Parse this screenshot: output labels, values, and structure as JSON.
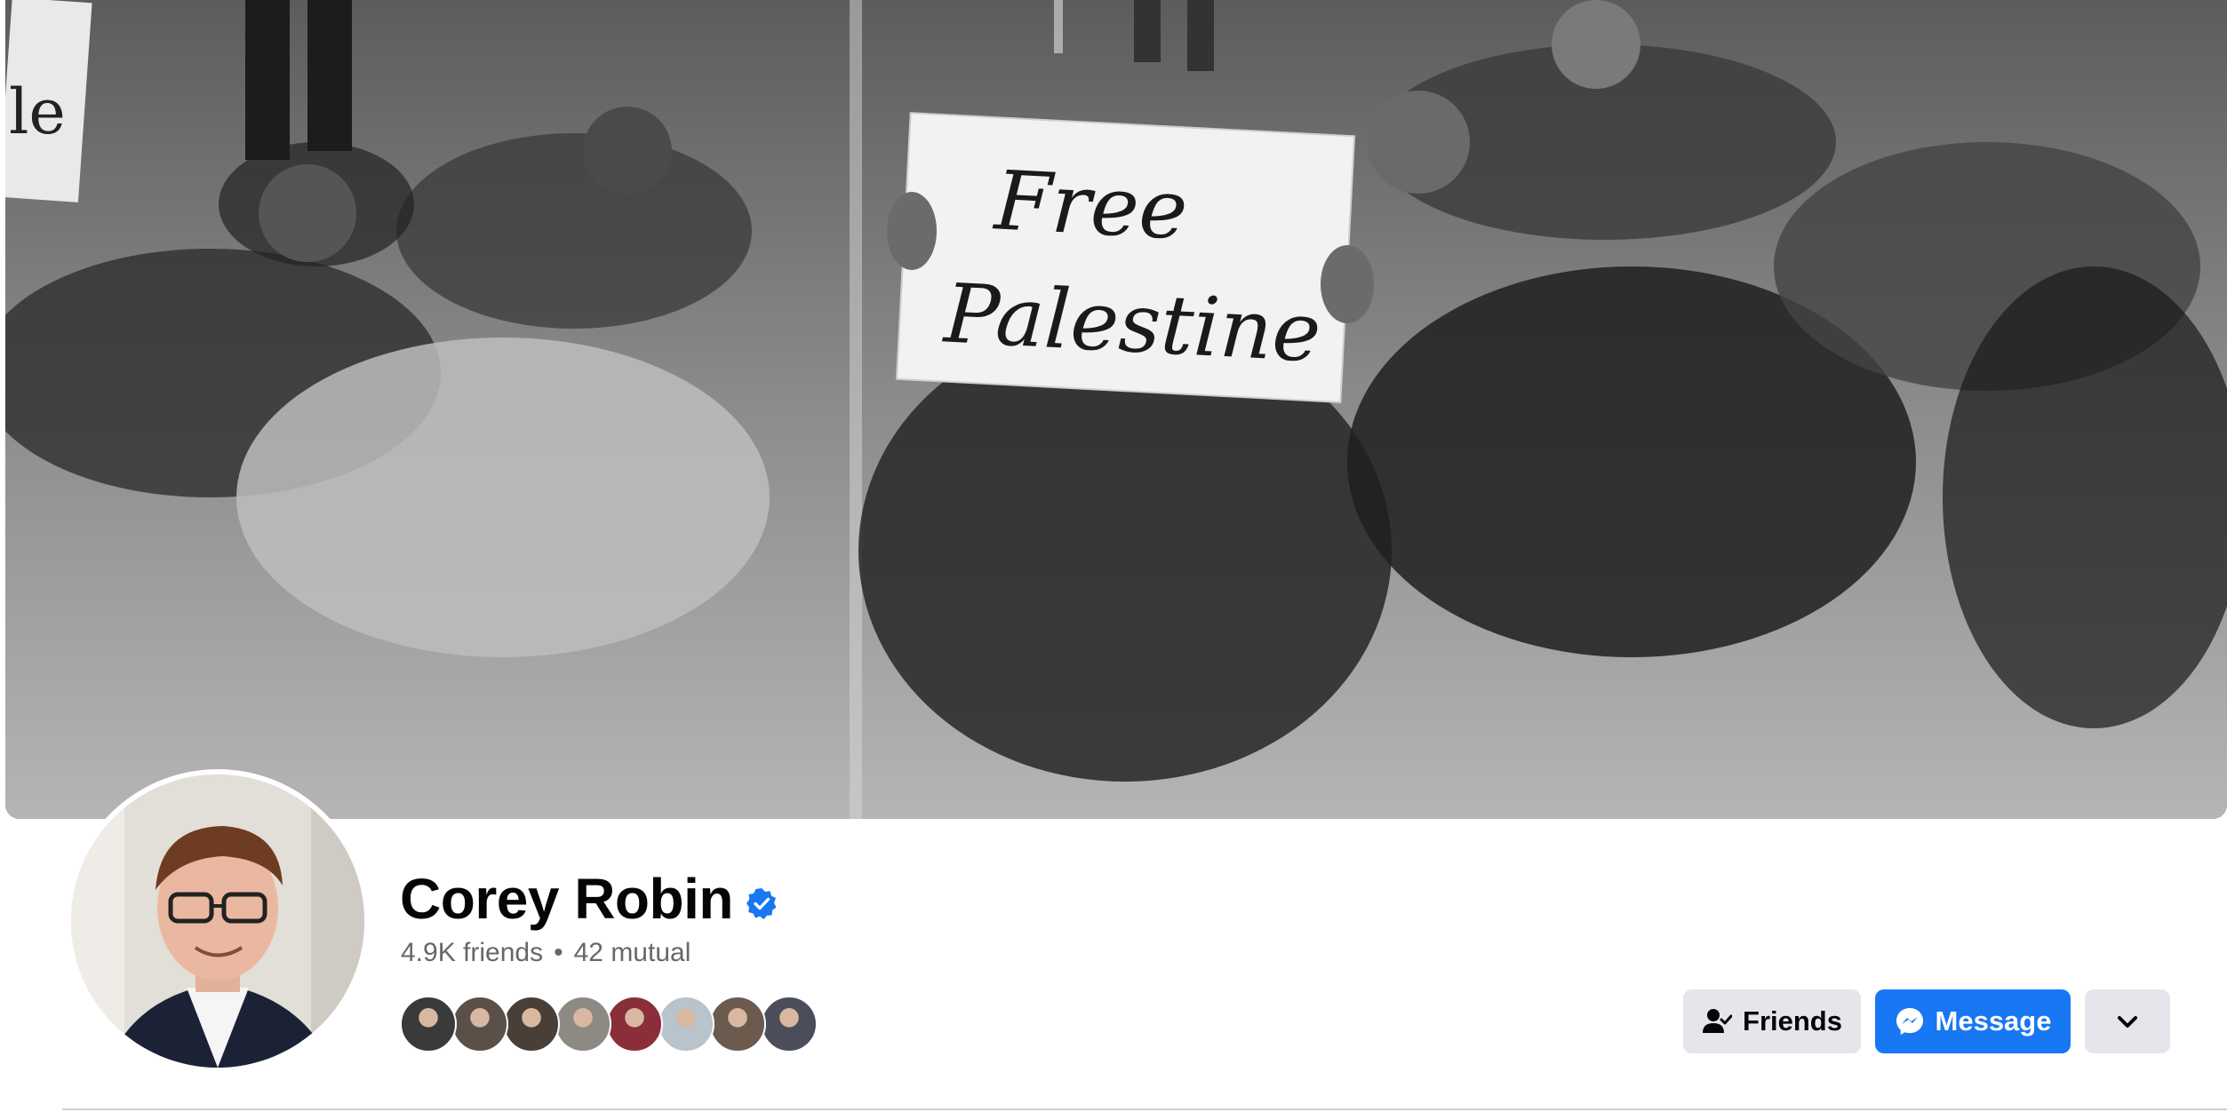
{
  "cover": {
    "sign_line1": "Free",
    "sign_line2": "Palestine",
    "left_sign_fragment": "le"
  },
  "profile": {
    "name": "Corey Robin",
    "verified": true,
    "friends_count": "4.9K friends",
    "separator": "•",
    "mutual_count": "42 mutual"
  },
  "mutual_friends": [
    {
      "color": "#3a3a3a"
    },
    {
      "color": "#5a5048"
    },
    {
      "color": "#4a3f36"
    },
    {
      "color": "#8d8a84"
    },
    {
      "color": "#8a2f3a"
    },
    {
      "color": "#b9c3cc"
    },
    {
      "color": "#6b5a4e"
    },
    {
      "color": "#4b4e5a"
    }
  ],
  "actions": {
    "friends_label": "Friends",
    "message_label": "Message"
  },
  "colors": {
    "accent": "#1877f2",
    "secondary_button": "#e4e6eb",
    "muted_text": "#65676b"
  }
}
